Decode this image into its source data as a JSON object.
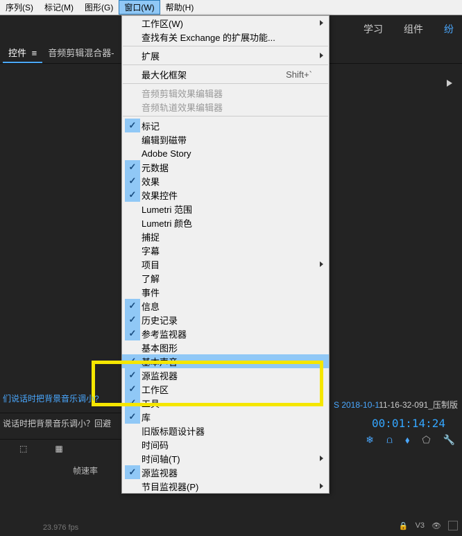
{
  "menubar": {
    "items": [
      "序列(S)",
      "标记(M)",
      "图形(G)",
      "窗口(W)",
      "帮助(H)"
    ],
    "active_index": 3
  },
  "toolbar_top": {
    "learn": "学习",
    "component": "组件",
    "extra": "纷"
  },
  "panel_tabs": {
    "active": "控件",
    "icon": "≡",
    "second": "音频剪辑混合器-"
  },
  "dropdown": {
    "items": [
      {
        "label": "工作区(W)",
        "sub": true
      },
      {
        "label": "查找有关 Exchange 的扩展功能..."
      },
      {
        "sep": true
      },
      {
        "label": "扩展",
        "sub": true
      },
      {
        "sep": true
      },
      {
        "label": "最大化框架",
        "accel": "Shift+`"
      },
      {
        "sep": true
      },
      {
        "label": "音频剪辑效果编辑器",
        "disabled": true
      },
      {
        "label": "音频轨道效果编辑器",
        "disabled": true
      },
      {
        "sep": true
      },
      {
        "label": "标记",
        "checked": true
      },
      {
        "label": "编辑到磁带"
      },
      {
        "label": "Adobe Story"
      },
      {
        "label": "元数据",
        "checked": true
      },
      {
        "label": "效果",
        "checked": true
      },
      {
        "label": "效果控件",
        "checked": true
      },
      {
        "label": "Lumetri 范围"
      },
      {
        "label": "Lumetri 颜色"
      },
      {
        "label": "捕捉"
      },
      {
        "label": "字幕"
      },
      {
        "label": "项目",
        "sub": true
      },
      {
        "label": "了解"
      },
      {
        "label": "事件"
      },
      {
        "label": "信息",
        "checked": true
      },
      {
        "label": "历史记录",
        "checked": true
      },
      {
        "label": "参考监视器",
        "checked": true
      },
      {
        "label": "基本图形"
      },
      {
        "label": "基本声音",
        "checked": true,
        "highlighted": true
      },
      {
        "label": "源监视器",
        "checked": true
      },
      {
        "label": "工作区",
        "checked": true
      },
      {
        "label": "工具",
        "checked": true
      },
      {
        "label": "库",
        "checked": true
      },
      {
        "label": "旧版标题设计器"
      },
      {
        "label": "时间码"
      },
      {
        "label": "时间轴(T)",
        "sub": true
      },
      {
        "label": "源监视器",
        "checked": true
      },
      {
        "label": "节目监视器(P)",
        "sub": true
      }
    ]
  },
  "bottom_left": {
    "row1": "们说话时把背景音乐调小?",
    "row2": "说话时把背景音乐调小？回避",
    "rate_label": "帧速率",
    "fps": "23.976 fps"
  },
  "filename": {
    "prefix": "S 2018-10-1",
    "rest": "11-16-32-091_压制版"
  },
  "timecode": "00:01:14:24",
  "track": {
    "label": "V3"
  },
  "icons": {
    "bin": "⬚",
    "newitem": "▦",
    "snow": "❄",
    "magnet": "⩍",
    "marker": "⬧",
    "shield": "⬠",
    "wrench": "🔧",
    "lock": "🔒",
    "eye": "👁",
    "mono": "▭"
  }
}
